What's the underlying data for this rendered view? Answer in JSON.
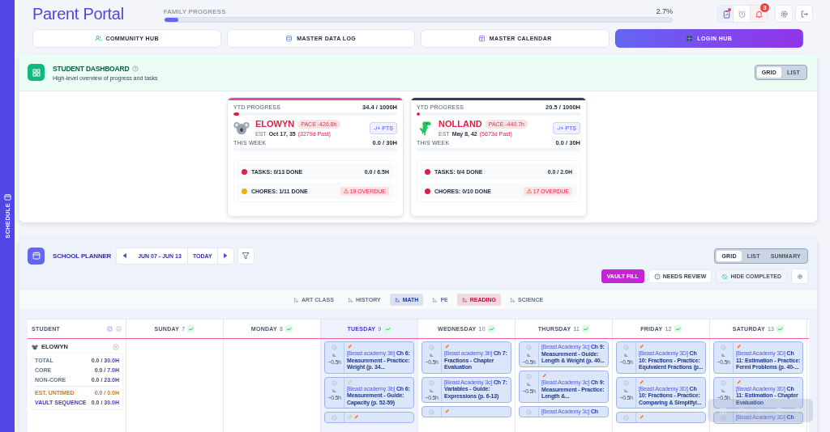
{
  "app": {
    "title": "Parent Portal",
    "side_tab": "SCHEDULE"
  },
  "family_progress": {
    "label": "FAMILY PROGRESS",
    "value": "2.7%",
    "level": 0.027
  },
  "header_icons": [
    {
      "kind": "tasks",
      "dot": true
    },
    {
      "kind": "alarm",
      "dot": false
    },
    {
      "kind": "bell",
      "dot": false,
      "badge": "3"
    },
    {
      "kind": "settings",
      "dot": false
    },
    {
      "kind": "logout",
      "dot": false
    }
  ],
  "nav": [
    {
      "label": "COMMUNITY HUB",
      "selected": false
    },
    {
      "label": "MASTER DATA LOG",
      "selected": false
    },
    {
      "label": "MASTER CALENDAR",
      "selected": false
    },
    {
      "label": "LOGIN HUB",
      "selected": true
    }
  ],
  "dashboard": {
    "title": "STUDENT DASHBOARD",
    "subtitle": "High-level overview of progress and tasks",
    "views": [
      {
        "label": "GRID",
        "selected": true
      },
      {
        "label": "LIST",
        "selected": false
      }
    ],
    "students": [
      {
        "name": "ELOWYN",
        "color": "#ec4899",
        "ytd_label": "YTD PROGRESS",
        "ytd": "34.4 / 1000H",
        "ytd_bar": {
          "level": 0.034
        },
        "pace": "PACE -426.8h",
        "est_label": "EST",
        "est": "Oct 17, 35",
        "past": "(3279d Past)",
        "pts": "-/+ PTS",
        "week_label": "THIS WEEK",
        "week": "0.0 / 30H",
        "tasks": {
          "label": "TASKS: 0/13 DONE",
          "value": "0.0 / 6.5H",
          "color": "#e11d48"
        },
        "chores": {
          "label": "CHORES: 1/11 DONE",
          "overdue": "19 OVERDUE",
          "color": "#eab308"
        }
      },
      {
        "name": "NOLLAND",
        "color": "#334155",
        "ytd_label": "YTD PROGRESS",
        "ytd": "20.5 / 1000H",
        "ytd_bar": {
          "level": 0.0205
        },
        "pace": "PACE -440.7h",
        "est_label": "EST",
        "est": "May 8, 42",
        "past": "(5673d Past)",
        "pts": "-/+ PTS",
        "week_label": "THIS WEEK",
        "week": "0.0 / 30H",
        "tasks": {
          "label": "TASKS: 0/4 DONE",
          "value": "0.0 / 2.0H",
          "color": "#e11d48"
        },
        "chores": {
          "label": "CHORES: 0/10 DONE",
          "overdue": "17 OVERDUE",
          "color": "#e11d48"
        }
      }
    ]
  },
  "planner": {
    "title": "SCHOOL PLANNER",
    "range": "JUN 07 - JUN 13",
    "today": "TODAY",
    "views": [
      {
        "label": "GRID",
        "selected": true
      },
      {
        "label": "LIST",
        "selected": false
      },
      {
        "label": "SUMMARY",
        "selected": false
      }
    ],
    "actions": [
      {
        "label": "VAULT FILL",
        "kind": "primary"
      },
      {
        "label": "NEEDS REVIEW",
        "kind": "review"
      },
      {
        "label": "HIDE COMPLETED",
        "kind": "hide"
      }
    ],
    "subjects": [
      {
        "label": "ART CLASS",
        "selected": false,
        "color": "#64748b"
      },
      {
        "label": "HISTORY",
        "selected": false,
        "color": "#64748b"
      },
      {
        "label": "MATH",
        "selected": true,
        "color": "#1e40af"
      },
      {
        "label": "PE",
        "selected": false,
        "color": "#64748b"
      },
      {
        "label": "READING",
        "selected": true,
        "color": "#be123c"
      },
      {
        "label": "SCIENCE",
        "selected": false,
        "color": "#64748b"
      }
    ],
    "student_header": "STUDENT",
    "days": [
      {
        "name": "SUNDAY",
        "date": "7",
        "selected": false
      },
      {
        "name": "MONDAY",
        "date": "8",
        "selected": false
      },
      {
        "name": "TUESDAY",
        "date": "9",
        "selected": true
      },
      {
        "name": "WEDNESDAY",
        "date": "10",
        "selected": false
      },
      {
        "name": "THURSDAY",
        "date": "11",
        "selected": false
      },
      {
        "name": "FRIDAY",
        "date": "12",
        "selected": false
      },
      {
        "name": "SATURDAY",
        "date": "13",
        "selected": false
      }
    ],
    "student": {
      "name": "ELOWYN",
      "stats": [
        {
          "label": "TOTAL",
          "value": "0.0 / 30.0H",
          "color": "#4338ca"
        },
        {
          "label": "CORE",
          "value": "0.0 / 7.0H",
          "color": "#4338ca"
        },
        {
          "label": "NON-CORE",
          "value": "0.0 / 23.0H",
          "color": "#4338ca"
        },
        {
          "label": "EST. UNTIMED",
          "value": "0.0 / 0.0H",
          "color": "#d97706"
        },
        {
          "label": "VAULT SEQUENCE",
          "value": "0.0 / 30.0H",
          "color": "#4338ca"
        }
      ]
    },
    "columns": [
      [],
      [],
      [
        {
          "source": "[Beast academy 3b]",
          "title": "Ch 6: Measurement - Practice: Weight (p. 34...",
          "duration": "~0.5h",
          "edited": true,
          "linked": false
        },
        {
          "source": "[Beast academy 3b]",
          "title": "Ch 6: Measurement - Guide: Capacity (p. 52-59)",
          "duration": "~0.5h",
          "edited": false,
          "linked": true
        },
        {
          "edited": true,
          "linked": true
        }
      ],
      [
        {
          "source": "[Beast academy 3b]",
          "title": "Ch 7: Fractions - Chapter Evaluation",
          "duration": "~0.5h",
          "edited": true,
          "linked": false
        },
        {
          "source": "[Beast Academy 3c]",
          "title": "Ch 7: Variables - Guide: Expressions (p. 6-13)",
          "duration": "~0.5h",
          "edited": false,
          "linked": false
        },
        {
          "edited": true,
          "linked": false
        }
      ],
      [
        {
          "source": "[Beast Academy 3c]",
          "title": "Ch 9: Measurement - Guide: Length & Weight (p. 40...",
          "duration": "~0.5h",
          "edited": false,
          "linked": false
        },
        {
          "source": "[Beast Academy 3c]",
          "title": "Ch 9: Measurement - Practice: Length &...",
          "duration": "~0.5h",
          "edited": true,
          "linked": false
        },
        {
          "source": "[Beast Academy 3c]",
          "title": "Ch",
          "edited": false,
          "linked": false
        }
      ],
      [
        {
          "source": "[Beast Academy 3D]",
          "title": "Ch 10: Fractions - Practice: Equivalent Fractions (p...",
          "duration": "~0.5h",
          "edited": true,
          "linked": false
        },
        {
          "source": "[Beast Academy 3D]",
          "title": "Ch 10: Fractions - Practice: Comparing & Simplifyi...",
          "duration": "~0.5h",
          "edited": true,
          "linked": false
        },
        {
          "edited": true,
          "linked": false
        }
      ],
      [
        {
          "source": "[Beast Academy 3D]",
          "title": "Ch 11: Estimation - Practice: Fermi Problems (p. 40-...",
          "duration": "~0.5h",
          "edited": true,
          "linked": false
        },
        {
          "source": "[Beast Academy 3D]",
          "title": "Ch 11: Estimation - Chapter Evaluation",
          "duration": "~0.5h",
          "edited": true,
          "linked": false
        },
        {
          "source": "[Beast Academy 3D]",
          "title": "Ch",
          "edited": false,
          "linked": false
        }
      ]
    ]
  }
}
